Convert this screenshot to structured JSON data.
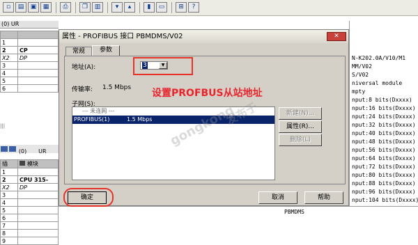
{
  "toolbar": {
    "icons": [
      "new-icon",
      "open-icon",
      "save-icon",
      "save-compile-icon",
      "print-icon",
      "copy-icon",
      "paste-icon",
      "download-icon",
      "upload-icon",
      "catalog-icon",
      "view-icon",
      "netpro-icon",
      "help-icon"
    ]
  },
  "station_window": {
    "title_prefix": "(0) UR",
    "rows_top": [
      "1",
      "2",
      "X2",
      "3",
      "4",
      "5",
      "6"
    ],
    "cpu_short": "CP",
    "dp_short": "DP",
    "lower_title_prefix": "(0)",
    "lower_title_suffix": "UR",
    "col_slot": "插",
    "col_module": "模块",
    "rows_bottom": [
      "1",
      "2",
      "X2",
      "3",
      "4",
      "5",
      "6",
      "7",
      "8",
      "9"
    ],
    "cpu_label": "CPU 315-",
    "dp_label": "DP"
  },
  "dialog": {
    "title": "属性 - PROFIBUS 接口  PBMDMS/V02",
    "close": "✕",
    "tabs": [
      {
        "label": "常规"
      },
      {
        "label": "参数"
      }
    ],
    "address_label": "地址(A):",
    "address_value": "3",
    "rate_label": "传输率:",
    "rate_value": "1.5 Mbps",
    "subnet_label": "子网(S):",
    "subnet_items": [
      {
        "name": "--- 未连网 ---",
        "rate": ""
      },
      {
        "name": "PROFIBUS(1)",
        "rate": "1.5 Mbps"
      }
    ],
    "btn_new": "新建(N)...",
    "btn_props": "属性(R)...",
    "btn_delete": "删除(L)",
    "btn_ok": "确定",
    "btn_cancel": "取消",
    "btn_help": "帮助"
  },
  "annotation": {
    "text": "设置PROFBUS从站地址",
    "color": "#e8252c"
  },
  "watermark": {
    "line1": "发布于",
    "line2": "gongkong"
  },
  "catalog": {
    "items": [
      "N-K202.0A/V10/M1",
      "MM/V02",
      "S/V02",
      "niversal module",
      "mpty",
      "nput:8 bits(Dxxxx)",
      "nput:16 bits(Dxxxx)",
      "nput:24 bits(Dxxxx)",
      "nput:32 bits(Dxxxx)",
      "nput:40 bits(Dxxxx)",
      "nput:48 bits(Dxxxx)",
      "nput:56 bits(Dxxxx)",
      "nput:64 bits(Dxxxx)",
      "nput:72 bits(Dxxxx)",
      "nput:80 bits(Dxxxx)",
      "nput:88 bits(Dxxxx)",
      "nput:96 bits(Dxxxx)",
      "nput:104 bits(Dxxxx)"
    ],
    "footer": "PBMDMS"
  }
}
